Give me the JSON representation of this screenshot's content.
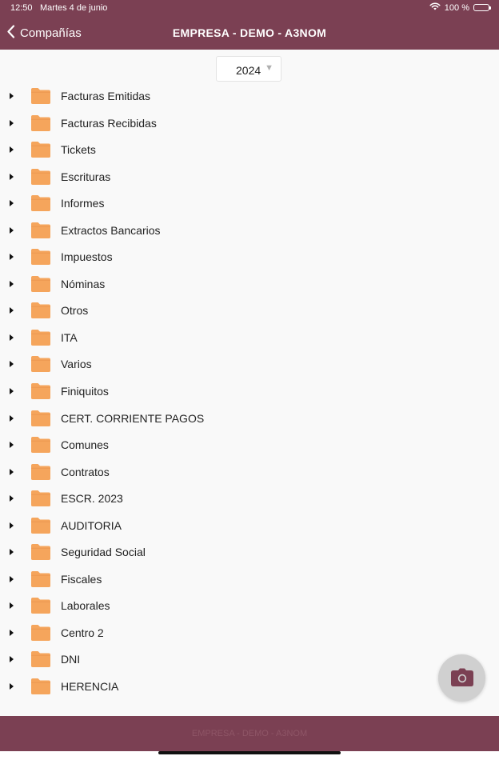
{
  "status_bar": {
    "time": "12:50",
    "date": "Martes 4 de junio",
    "battery": "100 %"
  },
  "nav": {
    "back_label": "Compañías",
    "title": "EMPRESA - DEMO - A3NOM"
  },
  "year_selector": {
    "value": "2024"
  },
  "folders": [
    "Facturas Emitidas",
    "Facturas Recibidas",
    "Tickets",
    "Escrituras",
    "Informes",
    "Extractos Bancarios",
    "Impuestos",
    "Nóminas",
    "Otros",
    "ITA",
    "Varios",
    "Finiquitos",
    "CERT. CORRIENTE PAGOS",
    "Comunes",
    "Contratos",
    "ESCR. 2023",
    "AUDITORIA",
    "Seguridad Social",
    "Fiscales",
    "Laborales",
    "Centro 2",
    "DNI",
    "HERENCIA"
  ],
  "footer": {
    "text": "EMPRESA - DEMO - A3NOM"
  },
  "colors": {
    "brand": "#7b4053",
    "folder": "#f5a55c"
  }
}
